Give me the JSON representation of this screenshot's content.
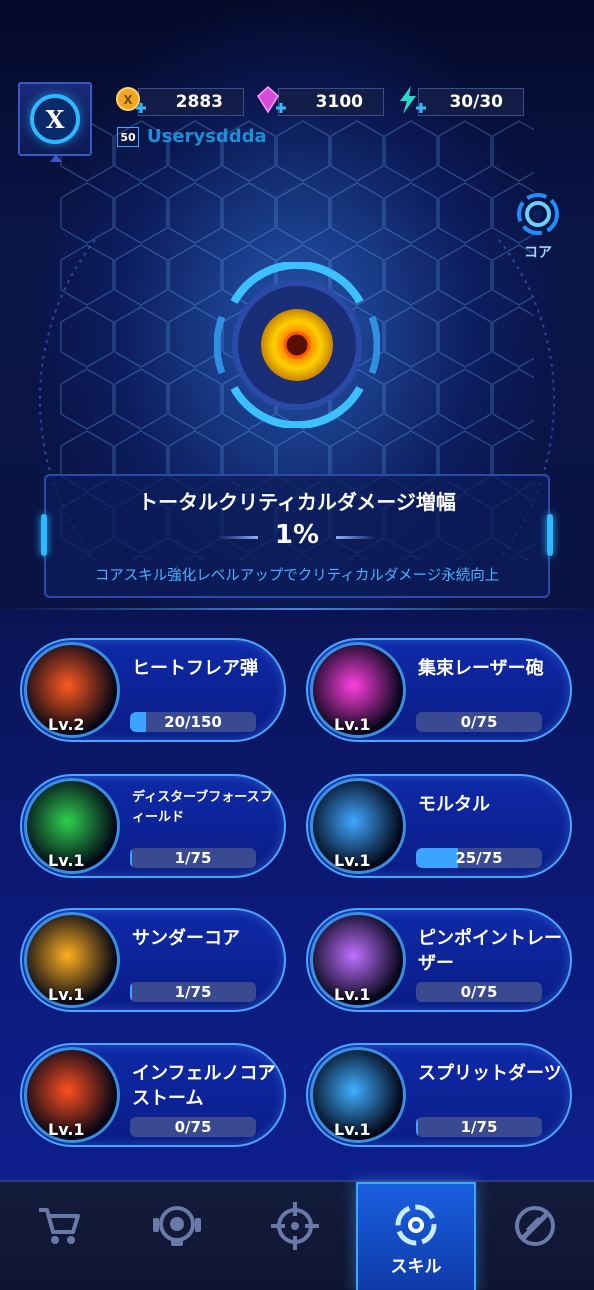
{
  "header": {
    "avatar_letter": "X",
    "coins": "2883",
    "gems": "3100",
    "energy": "30/30",
    "level": "50",
    "username": "Userysddda"
  },
  "core_button": {
    "label": "コア"
  },
  "stat": {
    "title": "トータルクリティカルダメージ増幅",
    "value": "1%",
    "description": "コアスキル強化レベルアップでクリティカルダメージ永続向上"
  },
  "skills": [
    {
      "name": "ヒートフレア弾",
      "level": "Lv.2",
      "progress": "20/150",
      "fill": 0.13,
      "color": "#ff5a20"
    },
    {
      "name": "集束レーザー砲",
      "level": "Lv.1",
      "progress": "0/75",
      "fill": 0,
      "color": "#ff40e0"
    },
    {
      "name": "ディスターブフォースフィールド",
      "level": "Lv.1",
      "progress": "1/75",
      "fill": 0.013,
      "color": "#30d050"
    },
    {
      "name": "モルタル",
      "level": "Lv.1",
      "progress": "25/75",
      "fill": 0.333,
      "color": "#40a8ff"
    },
    {
      "name": "サンダーコア",
      "level": "Lv.1",
      "progress": "1/75",
      "fill": 0.013,
      "color": "#ffb020"
    },
    {
      "name": "ピンポイントレーザー",
      "level": "Lv.1",
      "progress": "0/75",
      "fill": 0,
      "color": "#c070ff"
    },
    {
      "name": "インフェルノコアストーム",
      "level": "Lv.1",
      "progress": "0/75",
      "fill": 0,
      "color": "#ff5020"
    },
    {
      "name": "スプリットダーツ",
      "level": "Lv.1",
      "progress": "1/75",
      "fill": 0.013,
      "color": "#40b0ff"
    }
  ],
  "nav": {
    "active_label": "スキル",
    "items": [
      "shop-cart-icon",
      "robot-icon",
      "crosshair-icon",
      "skill-swirl-icon",
      "disabled-icon"
    ]
  }
}
